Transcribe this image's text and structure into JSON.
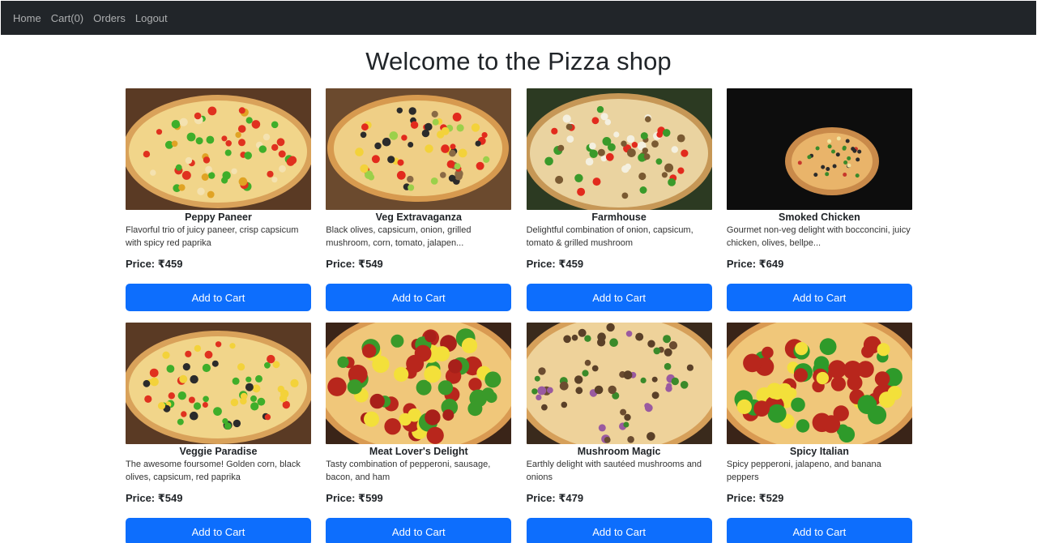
{
  "nav": {
    "items": [
      "Home",
      "Cart(0)",
      "Orders",
      "Logout"
    ]
  },
  "page_title": "Welcome to the Pizza shop",
  "add_label": "Add to Cart",
  "products": [
    {
      "name": "Peppy Paneer",
      "desc": "Flavorful trio of juicy paneer, crisp capsicum with spicy red paprika",
      "price": "Price: ₹459",
      "kind": "paneer"
    },
    {
      "name": "Veg Extravaganza",
      "desc": "Black olives, capsicum, onion, grilled mushroom, corn, tomato, jalapen...",
      "price": "Price: ₹549",
      "kind": "extravaganza"
    },
    {
      "name": "Farmhouse",
      "desc": "Delightful combination of onion, capsicum, tomato & grilled mushroom",
      "price": "Price: ₹459",
      "kind": "farmhouse"
    },
    {
      "name": "Smoked Chicken",
      "desc": "Gourmet non-veg delight with bocconcini, juicy chicken, olives, bellpe...",
      "price": "Price: ₹649",
      "kind": "chicken"
    },
    {
      "name": "Veggie Paradise",
      "desc": "The awesome foursome! Golden corn, black olives, capsicum, red paprika",
      "price": "Price: ₹549",
      "kind": "paradise"
    },
    {
      "name": "Meat Lover's Delight",
      "desc": "Tasty combination of pepperoni, sausage, bacon, and ham",
      "price": "Price: ₹599",
      "kind": "meat"
    },
    {
      "name": "Mushroom Magic",
      "desc": "Earthly delight with sautéed mushrooms and onions",
      "price": "Price: ₹479",
      "kind": "mushroom"
    },
    {
      "name": "Spicy Italian",
      "desc": "Spicy pepperoni, jalapeno, and banana peppers",
      "price": "Price: ₹529",
      "kind": "spicy"
    }
  ],
  "colors": {
    "navbar": "#212529",
    "button": "#0d6efd"
  }
}
